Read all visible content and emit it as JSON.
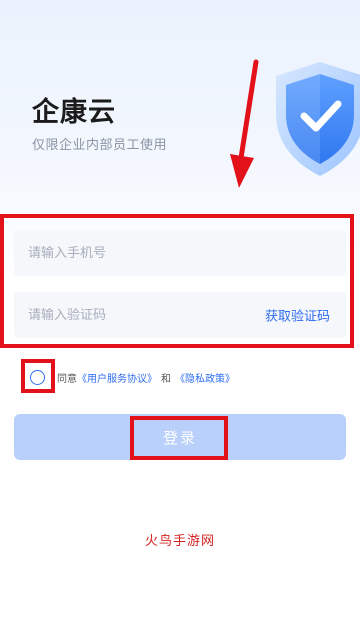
{
  "header": {
    "app_title": "企康云",
    "subtitle": "仅限企业内部员工使用"
  },
  "form": {
    "phone_placeholder": "请输入手机号",
    "code_placeholder": "请输入验证码",
    "get_code_label": "获取验证码"
  },
  "agreement": {
    "prefix": "同意",
    "user_agreement": "《用户服务协议》",
    "and": "和",
    "privacy_policy": "《隐私政策》",
    "checked": false
  },
  "login_button_label": "登录",
  "watermark": "火鸟手游网",
  "icons": {
    "hero": "shield-check-icon",
    "annotation": "arrow-down-icon"
  },
  "colors": {
    "accent": "#2f6df0",
    "button_disabled": "#b9d0fb",
    "annotation_red": "#e3111a"
  }
}
